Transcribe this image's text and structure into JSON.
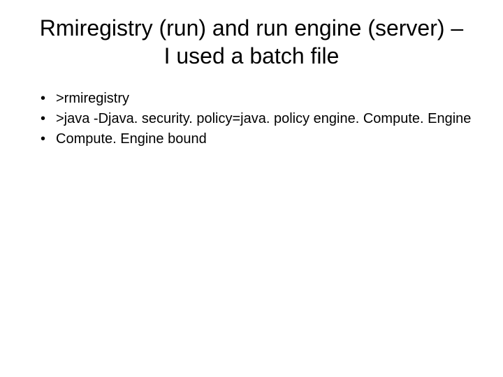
{
  "slide": {
    "title": "Rmiregistry (run) and run engine (server) – I used a batch file",
    "bullets": [
      ">rmiregistry",
      ">java   -Djava. security. policy=java. policy engine. Compute. Engine",
      "Compute. Engine bound"
    ]
  }
}
